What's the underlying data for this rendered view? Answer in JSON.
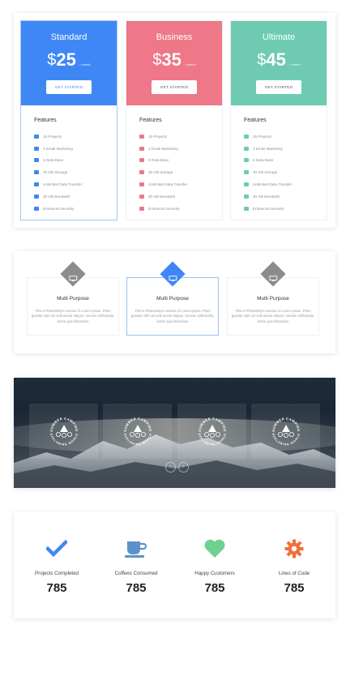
{
  "pricing": {
    "plans": [
      {
        "name": "Standard",
        "currency": "$",
        "price": "25",
        "period": "/ month",
        "button": "GET STARTED",
        "color": "#3f87f5"
      },
      {
        "name": "Business",
        "currency": "$",
        "price": "35",
        "period": "/ month",
        "button": "GET STARTED",
        "color": "#ee7788"
      },
      {
        "name": "Ultimate",
        "currency": "$",
        "price": "45",
        "period": "/ month",
        "button": "GET STARTED",
        "color": "#6ecbb2"
      }
    ],
    "features_title": "Features",
    "features": [
      "15 Projects",
      "2 Email Marketing",
      "5 Data Base",
      "30 GB Storage",
      "Unlimited Data Transfer",
      "30 GB Bandwith",
      "Enhanced Security"
    ]
  },
  "services": {
    "cards": [
      {
        "title": "Multi Purpose",
        "text": "This is Photoshop's version of Lorem Ipsum. Proin gravida nibh vel velit auctor aliquet. Aenean sollicitudin, lorem quis bibendum",
        "icon": "monitor-icon",
        "color": "#8c8c8c"
      },
      {
        "title": "Multi Purpose",
        "text": "This is Photoshop's version of Lorem Ipsum. Proin gravida nibh vel velit auctor aliquet. Aenean sollicitudin, lorem quis bibendum",
        "icon": "monitor-icon",
        "color": "#3f87f5"
      },
      {
        "title": "Multi Purpose",
        "text": "This is Photoshop's version of Lorem Ipsum. Proin gravida nibh vel velit auctor aliquet. Aenean sollicitudin, lorem quis bibendum",
        "icon": "monitor-icon",
        "color": "#8c8c8c"
      }
    ]
  },
  "slider": {
    "badge_top_text": "SUMMER CAMPING",
    "badge_bottom_text": "EXPLORING WORLD",
    "prev_icon": "chevron-left-icon",
    "next_icon": "chevron-right-icon"
  },
  "counters": [
    {
      "label": "Projects Completed",
      "value": "785",
      "icon": "check-icon",
      "color": "#3f87f5"
    },
    {
      "label": "Coffees Consumed",
      "value": "785",
      "icon": "coffee-cup-icon",
      "color": "#5b93c9"
    },
    {
      "label": "Happy Customers",
      "value": "785",
      "icon": "heart-icon",
      "color": "#6fd08f"
    },
    {
      "label": "Lines of Code",
      "value": "785",
      "icon": "gear-icon",
      "color": "#f26f3b"
    }
  ]
}
